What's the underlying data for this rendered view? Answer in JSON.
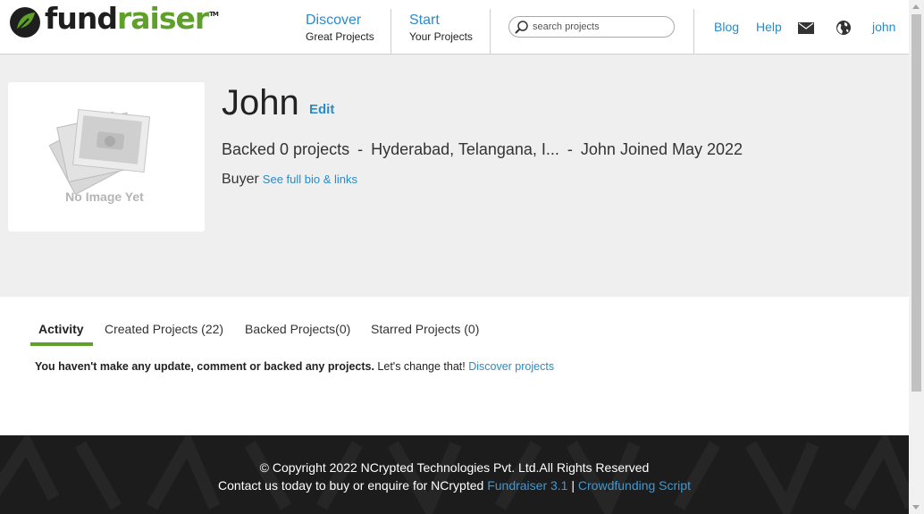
{
  "header": {
    "logo": {
      "fund": "fund",
      "raiser": "raiser",
      "tm": "TM"
    },
    "nav": [
      {
        "title": "Discover",
        "subtitle": "Great Projects"
      },
      {
        "title": "Start",
        "subtitle": "Your Projects"
      }
    ],
    "search": {
      "placeholder": "search projects",
      "value": ""
    },
    "links": {
      "blog": "Blog",
      "help": "Help",
      "user": "john"
    },
    "icons": {
      "mail": "mail-icon",
      "globe": "globe-icon",
      "search": "search-icon"
    }
  },
  "profile": {
    "name": "John",
    "edit_label": "Edit",
    "backed": "Backed 0 projects",
    "location": "Hyderabad, Telangana, I...",
    "joined": "John Joined May 2022",
    "separator": "-",
    "role": "Buyer",
    "bio_link": "See full bio & links",
    "avatar_text": "No Image Yet"
  },
  "tabs": [
    {
      "label": "Activity",
      "active": true
    },
    {
      "label": "Created Projects (22)",
      "active": false
    },
    {
      "label": "Backed Projects(0)",
      "active": false
    },
    {
      "label": "Starred Projects (0)",
      "active": false
    }
  ],
  "activity": {
    "bold_text": "You haven't make any update, comment or backed any projects.",
    "normal_text": " Let's change that! ",
    "link": "Discover projects"
  },
  "footer": {
    "copyright": "© Copyright 2022 NCrypted Technologies Pvt. Ltd.All Rights Reserved",
    "contact": "Contact us today to buy or enquire for NCrypted ",
    "product_link": "Fundraiser 3.1",
    "divider": " | ",
    "script_link": "Crowdfunding Script"
  },
  "colors": {
    "accent": "#2a8bc6",
    "brand_green": "#5ea02a",
    "footer_bg": "#1c1c1c",
    "profile_bg": "#efefef"
  }
}
